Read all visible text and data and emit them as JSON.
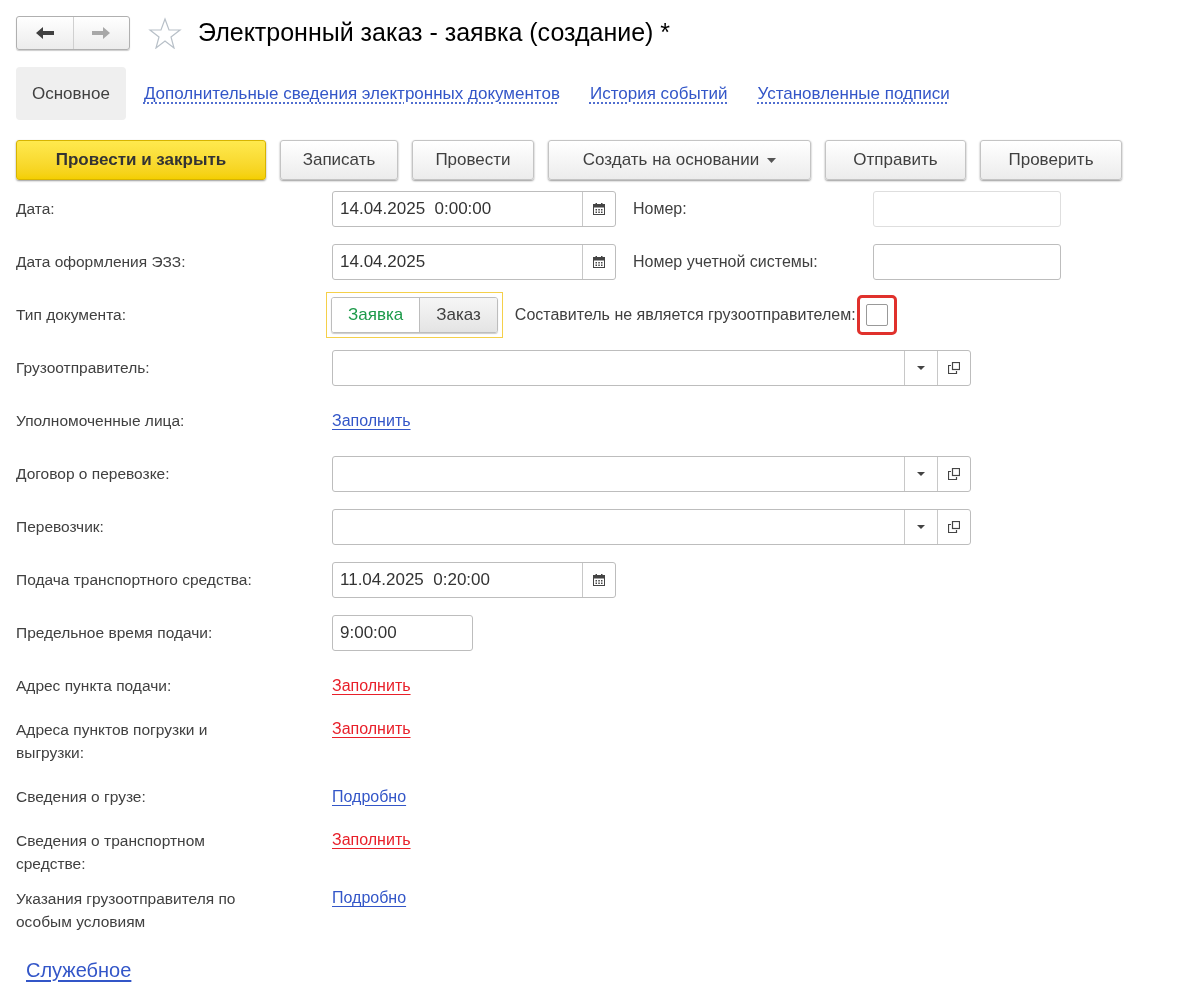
{
  "header": {
    "back_disabled": false,
    "forward_disabled": true,
    "favorite": false,
    "title": "Электронный заказ - заявка (создание) *"
  },
  "tabs": [
    {
      "label": "Основное",
      "selected": true
    },
    {
      "label": "Дополнительные сведения электронных документов",
      "selected": false
    },
    {
      "label": "История событий",
      "selected": false
    },
    {
      "label": "Установленные подписи",
      "selected": false
    }
  ],
  "buttons": [
    {
      "label": "Провести и закрыть",
      "kind": "primary"
    },
    {
      "label": "Записать",
      "kind": "default"
    },
    {
      "label": "Провести",
      "kind": "default"
    },
    {
      "label": "Создать на основании",
      "kind": "dropdown"
    },
    {
      "label": "Отправить",
      "kind": "default"
    },
    {
      "label": "Проверить",
      "kind": "default"
    }
  ],
  "rows": [
    {
      "label": "Дата:",
      "kind": "date",
      "value": "14.04.2025  0:00:00",
      "side": {
        "label": "Номер:",
        "kind": "text",
        "disabled": true
      }
    },
    {
      "label": "Дата оформления ЭЗЗ:",
      "kind": "date",
      "value": "14.04.2025",
      "side": {
        "label": "Номер учетной системы:",
        "kind": "text",
        "disabled": false
      }
    },
    {
      "label": "Тип документа:",
      "kind": "toggle",
      "options": [
        {
          "label": "Заявка",
          "selected": true
        },
        {
          "label": "Заказ",
          "selected": false
        }
      ],
      "side": {
        "label": "Составитель не является грузоотправителем:",
        "kind": "checkbox",
        "checked": false
      }
    },
    {
      "label": "Грузоотправитель:",
      "kind": "combo"
    },
    {
      "label": "Уполномоченные лица:",
      "kind": "link",
      "link": "Заполнить",
      "required": false
    },
    {
      "label": "Договор о перевозке:",
      "kind": "combo"
    },
    {
      "label": "Перевозчик:",
      "kind": "combo"
    },
    {
      "label": "Подача транспортного средства:",
      "kind": "date",
      "value": "11.04.2025  0:20:00"
    },
    {
      "label": "Предельное время подачи:",
      "kind": "time",
      "value": "9:00:00"
    },
    {
      "label": "Адрес пункта подачи:",
      "kind": "link",
      "link": "Заполнить",
      "required": true
    },
    {
      "label": "Адреса пунктов погрузки и выгрузки:",
      "kind": "link",
      "link": "Заполнить",
      "required": true
    },
    {
      "label": "Сведения о грузе:",
      "kind": "link",
      "link": "Подробно",
      "required": false
    },
    {
      "label": "Сведения о транспортном средстве:",
      "kind": "link",
      "link": "Заполнить",
      "required": true
    },
    {
      "label": "Указания грузоотправителя по особым условиям",
      "kind": "link",
      "link": "Подробно",
      "required": false
    }
  ],
  "footer_link": "Служебное"
}
